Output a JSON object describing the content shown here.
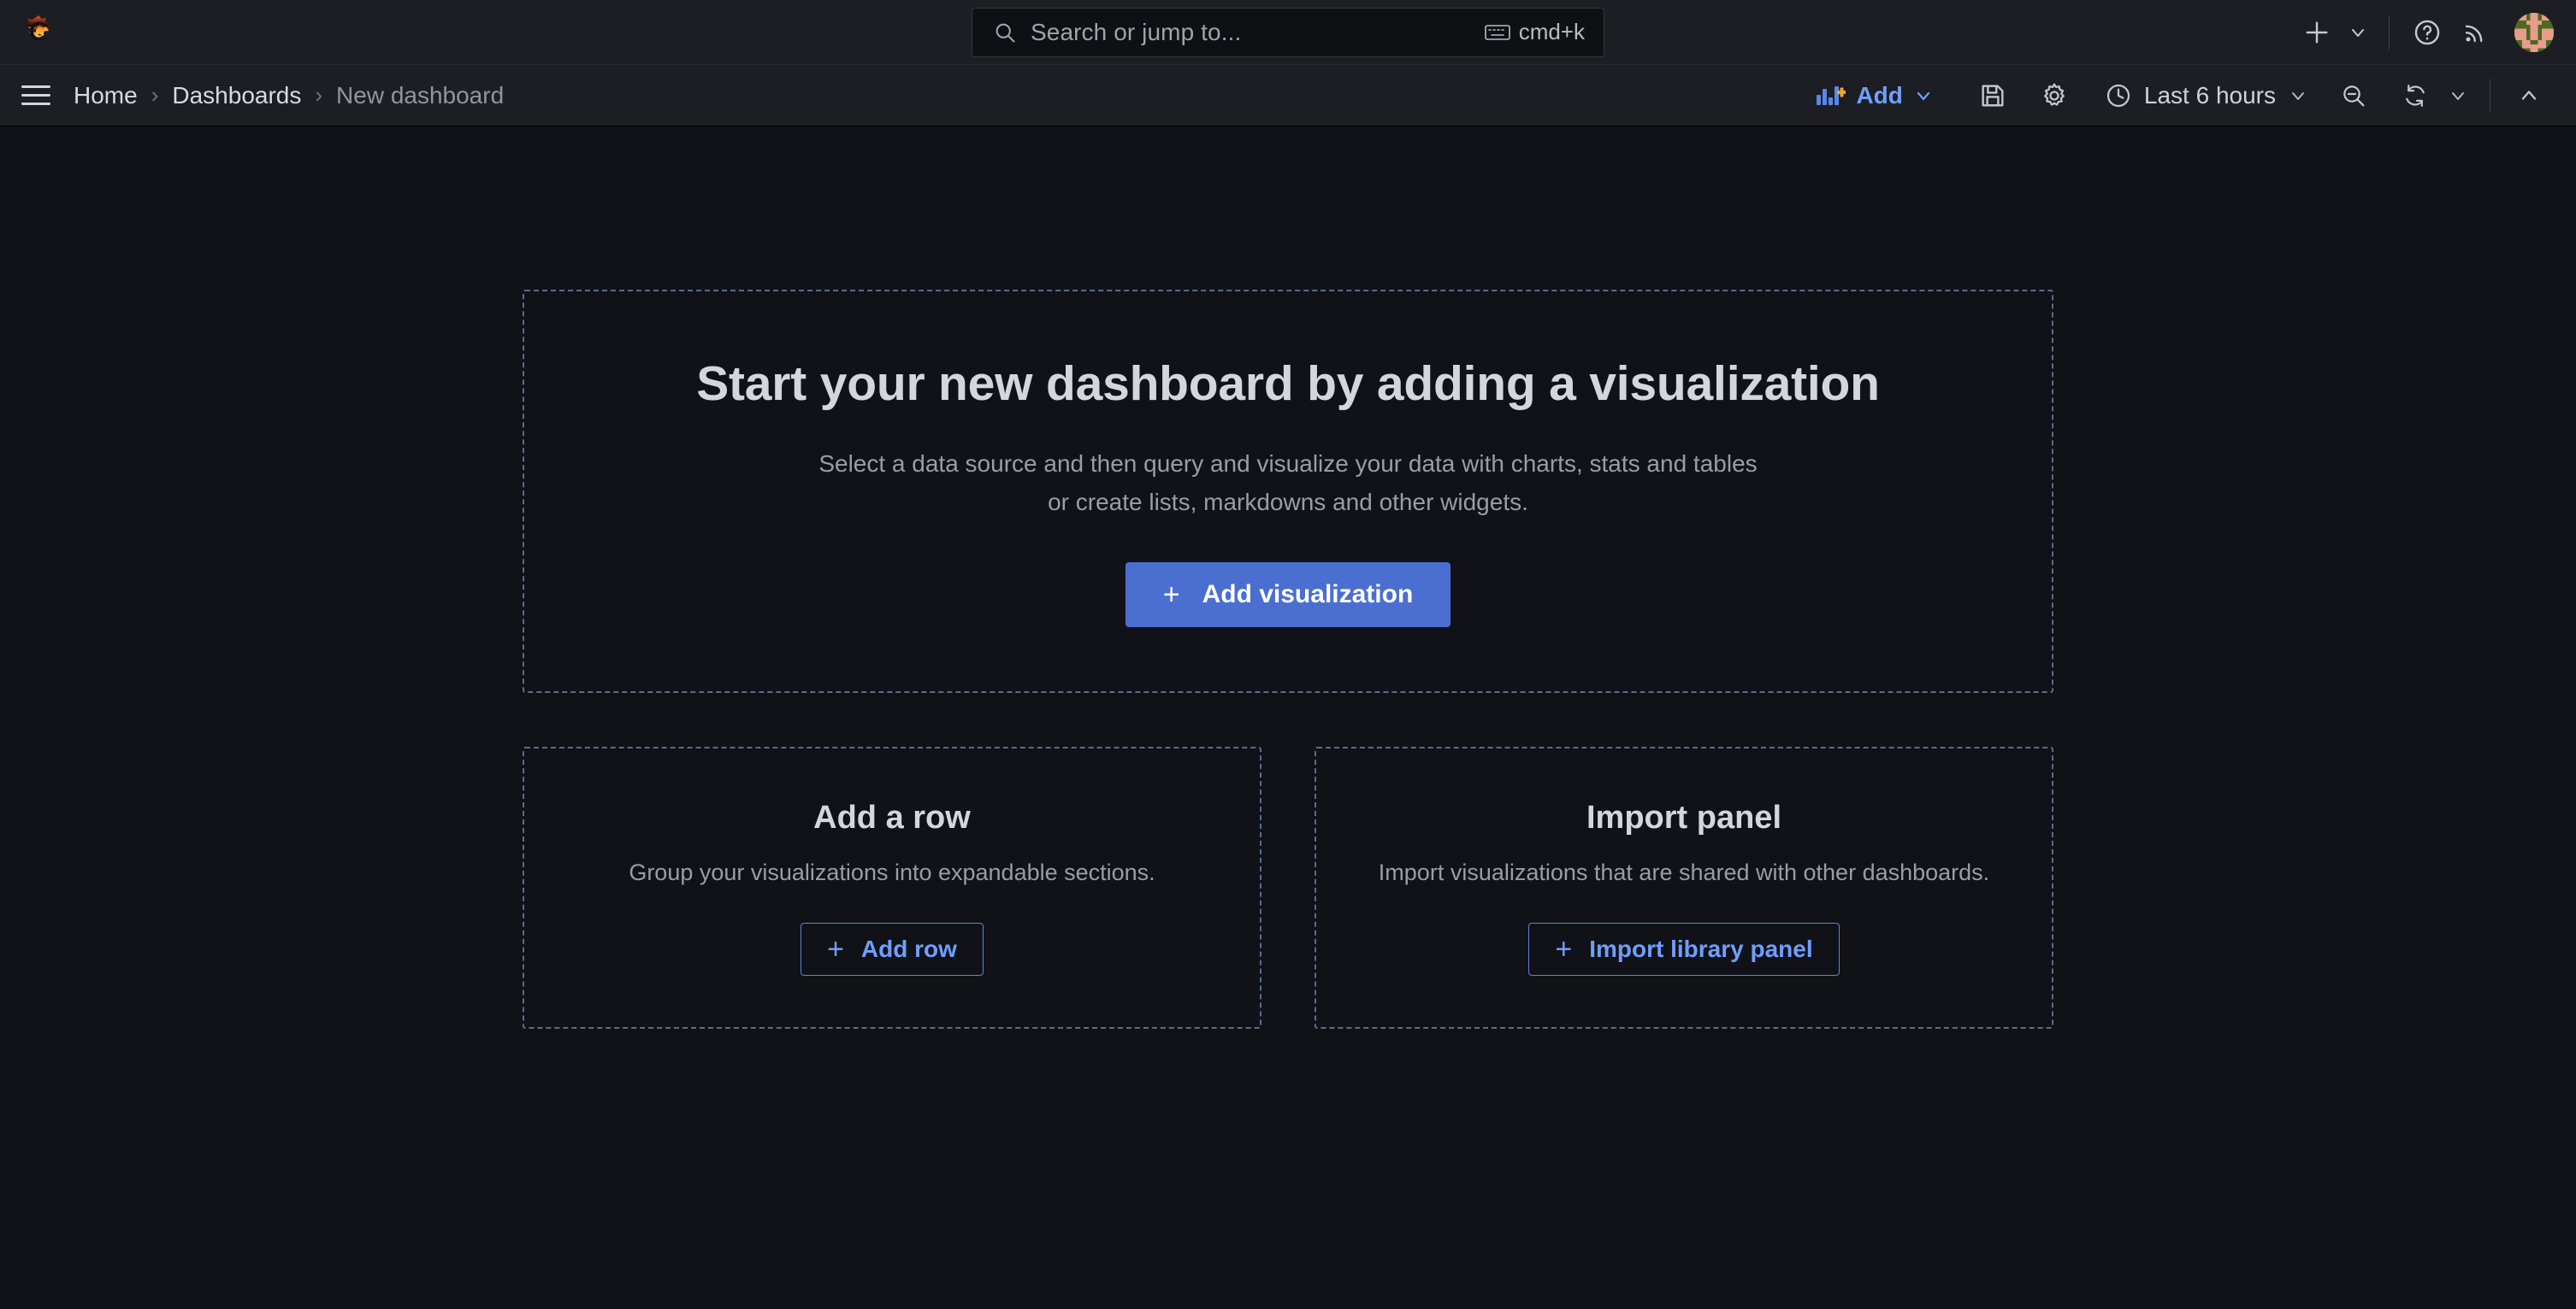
{
  "topbar": {
    "logo_icon": "grafana-logo-icon",
    "search": {
      "placeholder": "Search or jump to...",
      "icon": "search-icon",
      "shortcut_icon": "keyboard-icon",
      "shortcut": "cmd+k"
    },
    "actions": [
      {
        "icon": "plus-icon",
        "name": "new-button"
      },
      {
        "icon": "chevron-down-icon",
        "name": "new-menu-chevron"
      },
      {
        "icon": "help-circle-icon",
        "name": "help-button"
      },
      {
        "icon": "rss-icon",
        "name": "news-button"
      }
    ],
    "avatar_icon": "avatar",
    "avatar_bg": "#4d6a1e",
    "avatar_fg": "#e79c8e"
  },
  "toolbar": {
    "menu_icon": "hamburger-menu-icon",
    "breadcrumb": [
      {
        "label": "Home",
        "current": false
      },
      {
        "label": "Dashboards",
        "current": false
      },
      {
        "label": "New dashboard",
        "current": true
      }
    ],
    "breadcrumb_separator": "›",
    "add_label": "Add",
    "add_icon": "add-panel-icon",
    "save_icon": "save-icon",
    "settings_icon": "gear-icon",
    "time_range": "Last 6 hours",
    "time_icon": "clock-icon",
    "zoom_out_icon": "zoom-out-icon",
    "refresh_icon": "refresh-icon",
    "refresh_chevron_icon": "chevron-down-icon",
    "collapse_icon": "chevron-up-icon"
  },
  "hero": {
    "title": "Start your new dashboard by adding a visualization",
    "desc_line1": "Select a data source and then query and visualize your data with charts, stats and tables",
    "desc_line2": "or create lists, markdowns and other widgets.",
    "cta_label": "Add visualization",
    "cta_icon": "plus-icon"
  },
  "cards": [
    {
      "title": "Add a row",
      "desc": "Group your visualizations into expandable sections.",
      "button_label": "Add row",
      "button_icon": "plus-icon"
    },
    {
      "title": "Import panel",
      "desc": "Import visualizations that are shared with other dashboards.",
      "button_label": "Import library panel",
      "button_icon": "plus-icon"
    }
  ],
  "colors": {
    "page_bg": "#111217",
    "bar_bg": "#1c1e23",
    "primary_blue": "#4a6fd0",
    "link_blue": "#6e9fff",
    "dashed_border": "#5b6a93",
    "text_primary": "#d4d6dd",
    "text_secondary": "#9a9da6"
  }
}
